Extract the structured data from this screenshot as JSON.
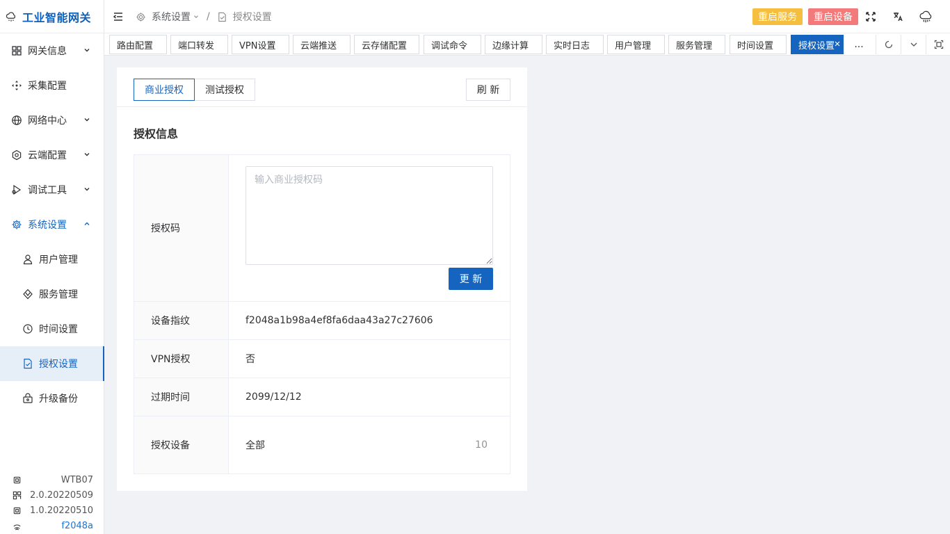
{
  "app": {
    "title": "工业智能网关"
  },
  "sidebar": {
    "items": [
      {
        "label": "网关信息",
        "icon": "grid-icon",
        "has_children": true
      },
      {
        "label": "采集配置",
        "icon": "move-icon",
        "has_children": false
      },
      {
        "label": "网络中心",
        "icon": "globe-icon",
        "has_children": true
      },
      {
        "label": "云端配置",
        "icon": "settings-cloud-icon",
        "has_children": true
      },
      {
        "label": "调试工具",
        "icon": "debug-icon",
        "has_children": true
      },
      {
        "label": "系统设置",
        "icon": "gear-icon",
        "has_children": true,
        "expanded": true
      }
    ],
    "sub_items": [
      {
        "label": "用户管理",
        "icon": "user-icon"
      },
      {
        "label": "服务管理",
        "icon": "service-icon"
      },
      {
        "label": "时间设置",
        "icon": "clock-icon"
      },
      {
        "label": "授权设置",
        "icon": "license-icon",
        "selected": true
      },
      {
        "label": "升级备份",
        "icon": "upgrade-icon"
      }
    ],
    "device_info": [
      {
        "icon": "chip-icon",
        "value": "WTB07"
      },
      {
        "icon": "qrcode-icon",
        "value": "2.0.20220509"
      },
      {
        "icon": "chip-icon",
        "value": "1.0.20220510"
      },
      {
        "icon": "fingerprint-icon",
        "value": "f2048a"
      }
    ]
  },
  "header": {
    "breadcrumb": {
      "parent": "系统设置",
      "current": "授权设置"
    },
    "restart_service_label": "重启服务",
    "restart_device_label": "重启设备"
  },
  "tabs": {
    "items": [
      "路由配置",
      "端口转发",
      "VPN设置",
      "云端推送",
      "云存储配置",
      "调试命令",
      "边缘计算",
      "实时日志",
      "用户管理",
      "服务管理",
      "时间设置",
      "授权设置"
    ],
    "active": "授权设置",
    "more_label": "..."
  },
  "license": {
    "tab_commercial": "商业授权",
    "tab_test": "测试授权",
    "refresh_label": "刷 新",
    "section_title": "授权信息",
    "code_label": "授权码",
    "code_placeholder": "输入商业授权码",
    "update_label": "更 新",
    "fingerprint_label": "设备指纹",
    "fingerprint_value": "f2048a1b98a4ef8fa6daa43a27c27606",
    "vpn_label": "VPN授权",
    "vpn_value": "否",
    "expire_label": "过期时间",
    "expire_value": "2099/12/12",
    "devices_label": "授权设备",
    "devices_value": "全部",
    "devices_count": "10"
  },
  "colors": {
    "primary": "#1565c0",
    "warning": "#f5be3f",
    "danger": "#f27a7a"
  }
}
